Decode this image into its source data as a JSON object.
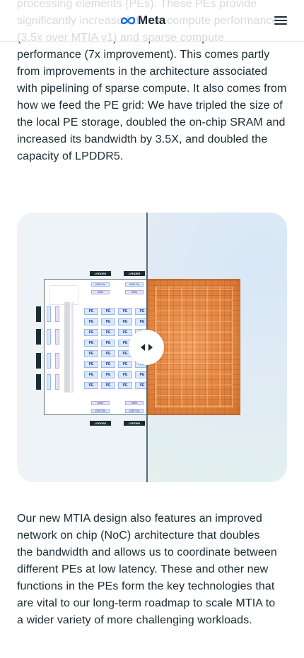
{
  "header": {
    "brand": "Meta",
    "logo_icon": "meta-infinity-icon",
    "menu_icon": "hamburger-menu-icon"
  },
  "article": {
    "paragraph_top": "processing elements (PEs). These PEs provide significantly increased dense compute performance (3.5x over MTIA v1) and sparse compute performance (7x improvement). This comes partly from improvements in the architecture associated with pipelining of sparse compute. It also comes from how we feed the PE grid: We have tripled the size of the local PE storage, doubled the on-chip SRAM and increased its bandwidth by 3.5X, and doubled the capacity of LPDDR5.",
    "paragraph_bottom": "Our new MTIA design also features an improved network on chip (NoC) architecture that doubles the bandwidth and allows us to coordinate between different PEs at low latency. These and other new functions in the PEs form the key technologies that are vital to our long-term roadmap to scale MTIA to a wider variety of more challenging workloads."
  },
  "comparison": {
    "handle_icon": "left-right-arrows-icon",
    "diagram": {
      "ddr_label": "LPDDR5",
      "ctrl_label": "DDR Ctrl",
      "mem_label": "MEM",
      "pe_label": "PE",
      "pe_rows": 8,
      "pe_cols": 4
    }
  }
}
